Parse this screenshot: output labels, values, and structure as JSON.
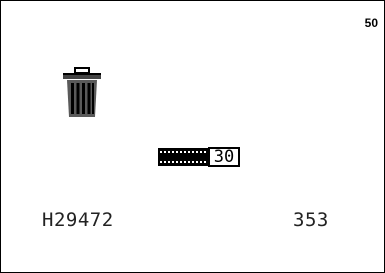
{
  "header": {
    "page_number": "50"
  },
  "icons": {
    "trash": "trash-can-icon",
    "film": "film-strip-icon"
  },
  "frame_counter": "30",
  "footer": {
    "code": "H29472",
    "value": "353"
  },
  "colors": {
    "foreground": "#000000",
    "background": "#ffffff"
  }
}
